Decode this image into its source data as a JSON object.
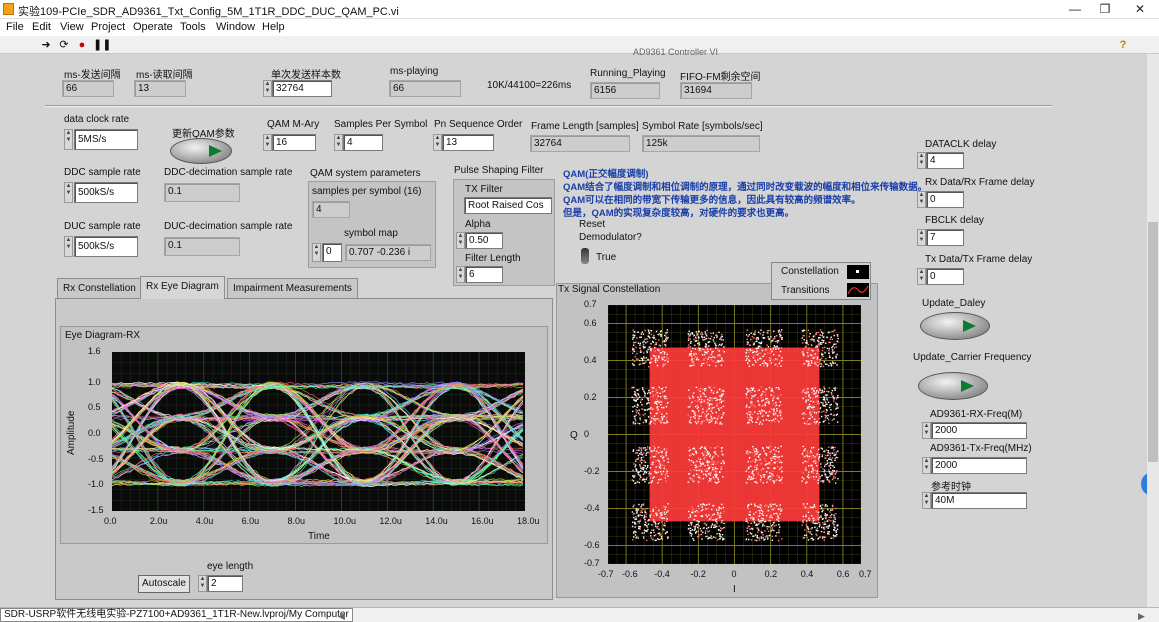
{
  "window": {
    "title": "实验109-PCIe_SDR_AD9361_Txt_Config_5M_1T1R_DDC_DUC_QAM_PC.vi"
  },
  "menu": [
    "File",
    "Edit",
    "View",
    "Project",
    "Operate",
    "Tools",
    "Window",
    "Help"
  ],
  "header": {
    "faded_label": "AD9361 Controller VI",
    "ms_send_label": "ms-发送间隔",
    "ms_send_value": "66",
    "ms_read_label": "ms-读取间隔",
    "ms_read_value": "13",
    "single_samples_label": "单次发送样本数",
    "single_samples_value": "32764",
    "ms_playing_label": "ms-playing",
    "ms_playing_value": "66",
    "rate_text": "10K/44100=226ms",
    "running_playing_label": "Running_Playing",
    "running_playing_value": "6156",
    "fifo_label": "FIFO-FM剩余空间",
    "fifo_value": "31694"
  },
  "left": {
    "data_clock_label": "data clock rate",
    "data_clock_value": "5MS/s",
    "update_qam_label": "更新QAM参数",
    "ddc_label": "DDC sample rate",
    "ddc_value": "500kS/s",
    "ddc_dec_label": "DDC-decimation sample rate",
    "ddc_dec_value": "0.1",
    "duc_label": "DUC sample rate",
    "duc_value": "500kS/s",
    "duc_dec_label": "DUC-decimation sample rate",
    "duc_dec_value": "0.1"
  },
  "qam": {
    "mary_label": "QAM M-Ary",
    "mary_value": "16",
    "sps_label": "Samples Per Symbol",
    "sps_value": "4",
    "pn_label": "Pn Sequence Order",
    "pn_value": "13",
    "frame_label": "Frame Length [samples]",
    "frame_value": "32764",
    "symrate_label": "Symbol Rate [symbols/sec]",
    "symrate_value": "125k",
    "sys_params_label": "QAM system parameters",
    "sps16_label": "samples per symbol (16)",
    "sps16_value": "4",
    "symbol_map_label": "symbol map",
    "symbol_map_index": "0",
    "symbol_map_value": "0.707 -0.236 i"
  },
  "pulse": {
    "title": "Pulse Shaping Filter",
    "tx_filter_label": "TX Filter",
    "tx_filter_value": "Root Raised Cos",
    "alpha_label": "Alpha",
    "alpha_value": "0.50",
    "filter_length_label": "Filter Length",
    "filter_length_value": "6"
  },
  "info": {
    "title": "QAM(正交幅度调制)",
    "line1": "QAM结合了幅度调制和相位调制的原理，通过同时改变载波的幅度和相位来传输数据。",
    "line2": "QAM可以在相同的带宽下传输更多的信息，因此具有较高的频谱效率。",
    "line3": "但是，QAM的实现复杂度较高，对硬件的要求也更高。"
  },
  "reset": {
    "label1": "Reset",
    "label2": "Demodulator?",
    "state": "True"
  },
  "tabs": [
    {
      "label": "Rx Constellation",
      "active": false
    },
    {
      "label": "Rx Eye Diagram",
      "active": true
    },
    {
      "label": "Impairment Measurements",
      "active": false
    }
  ],
  "eye": {
    "title": "Eye Diagram-RX",
    "ylabel": "Amplitude",
    "xlabel": "Time",
    "yticks": [
      "1.6",
      "1.0",
      "0.5",
      "0.0",
      "-0.5",
      "-1.0",
      "-1.5"
    ],
    "xticks": [
      "0.0",
      "2.0u",
      "4.0u",
      "6.0u",
      "8.0u",
      "10.0u",
      "12.0u",
      "14.0u",
      "16.0u",
      "18.0u"
    ],
    "autoscale_label": "Autoscale",
    "eye_length_label": "eye length",
    "eye_length_value": "2"
  },
  "const_plot": {
    "title": "Tx Signal Constellation",
    "ylabel": "Q",
    "xlabel": "I",
    "legend_const": "Constellation",
    "legend_trans": "Transitions",
    "yticks": [
      "0.7",
      "0.6",
      "0.4",
      "0.2",
      "0",
      "-0.2",
      "-0.4",
      "-0.6",
      "-0.7"
    ],
    "xticks": [
      "-0.7",
      "-0.6",
      "-0.4",
      "-0.2",
      "0",
      "0.2",
      "0.4",
      "0.6",
      "0.7"
    ]
  },
  "right": {
    "dataclk_label": "DATACLK delay",
    "dataclk_value": "4",
    "rxframe_label": "Rx Data/Rx Frame delay",
    "rxframe_value": "0",
    "fbclk_label": "FBCLK delay",
    "fbclk_value": "7",
    "txframe_label": "Tx Data/Tx Frame delay",
    "txframe_value": "0",
    "update_delay_label": "Update_Daley",
    "update_carrier_label": "Update_Carrier Frequency",
    "rxfreq_label": "AD9361-RX-Freq(M)",
    "rxfreq_value": "2000",
    "txfreq_label": "AD9361-Tx-Freq(MHz)",
    "txfreq_value": "2000",
    "ref_label": "参考时钟",
    "ref_value": "40M"
  },
  "status": {
    "path": "SDR-USRP软件无线电实验-PZ7100+AD9361_1T1R-New.lvproj/My Computer"
  },
  "colors": {
    "eye_bg": "#0a0a0a",
    "const_bg": "#000000",
    "grid": "#7e7e20",
    "const_point": "#ff3b3b",
    "info_text": "#1a3fa8",
    "run_green": "#0a7d33"
  }
}
